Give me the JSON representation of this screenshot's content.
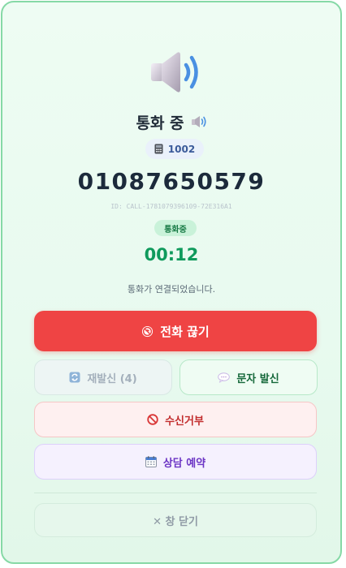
{
  "call": {
    "title": "통화 중",
    "extension": "1002",
    "phone_number": "01087650579",
    "call_id": "ID: CALL-1781079396109-72E316A1",
    "status_badge": "통화중",
    "timer": "00:12",
    "status_message": "통화가 연결되었습니다."
  },
  "buttons": {
    "hangup": "전화 끊기",
    "redial": "재발신 (4)",
    "sms": "문자 발신",
    "reject": "수신거부",
    "reserve": "상담 예약",
    "close": "✕ 창 닫기"
  },
  "icons": {
    "main": "speaker-icon",
    "title": "speaker-small-icon",
    "extension": "phone-handset-icon",
    "hangup": "no-phone-icon",
    "redial": "redial-icon",
    "sms": "speech-bubble-icon",
    "reject": "prohibited-icon",
    "reserve": "calendar-icon"
  },
  "colors": {
    "accent_green": "#0f9a5c",
    "danger_red": "#ef4444",
    "border_green": "#86d9a6",
    "purple": "#6b34c4"
  }
}
